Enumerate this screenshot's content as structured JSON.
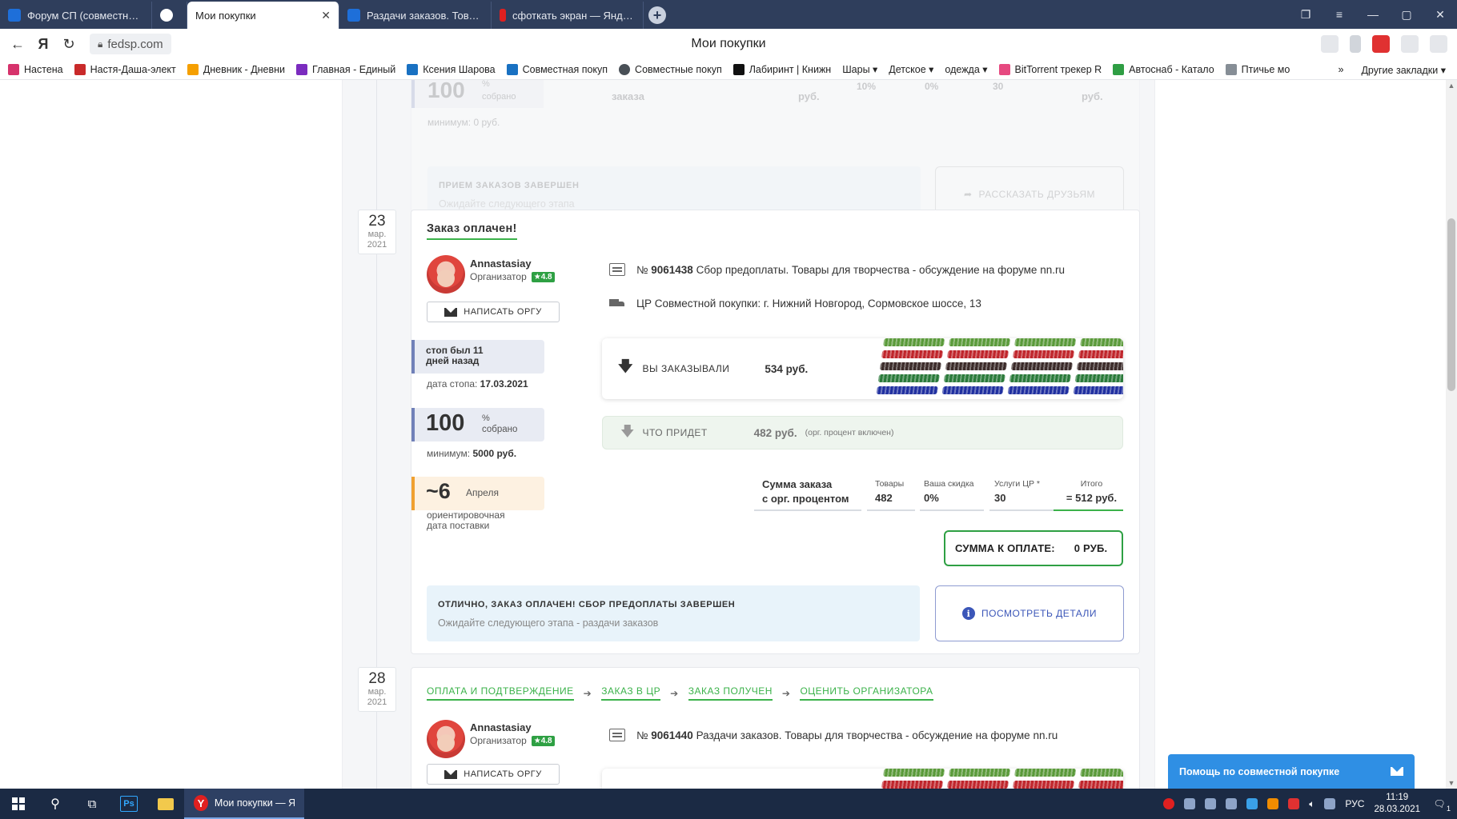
{
  "browser": {
    "tabs": [
      {
        "label": "Форум СП (совместных покупок)",
        "color": "#1e6fd9",
        "active": false
      },
      {
        "label": "",
        "color": "#2f3e5c",
        "active": false
      },
      {
        "label": "Мои покупки",
        "color": "#ffffff",
        "active": true
      },
      {
        "label": "Раздачи заказов. Товары",
        "color": "#1e6fd9",
        "active": false
      },
      {
        "label": "сфоткать экран — Яндекс",
        "color": "#e02020",
        "active": false
      }
    ],
    "url": "fedsp.com",
    "page_title": "Мои покупки",
    "bookmarks": [
      {
        "label": "Настена",
        "color": "#d6336c"
      },
      {
        "label": "Настя-Даша-элект",
        "color": "#c92a2a"
      },
      {
        "label": "Дневник - Дневни",
        "color": "#f59f00"
      },
      {
        "label": "Главная - Единый",
        "color": "#7b2cbf"
      },
      {
        "label": "Ксения Шарова",
        "color": "#1971c2"
      },
      {
        "label": "Совместная покуп",
        "color": "#1971c2"
      },
      {
        "label": "Совместные покуп",
        "color": "#495057"
      },
      {
        "label": "Лабиринт | Книжн",
        "color": "#111111"
      },
      {
        "label": "Шары ▾",
        "color": ""
      },
      {
        "label": "Детское ▾",
        "color": ""
      },
      {
        "label": "одежда ▾",
        "color": ""
      },
      {
        "label": "BitTorrent трекер R",
        "color": "#e64980"
      },
      {
        "label": "Автоснаб - Катало",
        "color": "#2f9e44"
      },
      {
        "label": "Птичье мо",
        "color": "#868e96"
      }
    ],
    "other_bookmarks": "Другие закладки ▾"
  },
  "faded_card": {
    "percent": "100",
    "percent_unit": "%",
    "percent_label": "собрано",
    "minimum": "минимум: 0 руб.",
    "col1": "заказа",
    "col2": "руб.",
    "col3": "10%",
    "col4": "0%",
    "col5": "30",
    "col6": "руб.",
    "notice_title": "ПРИЕМ ЗАКАЗОВ ЗАВЕРШЕН",
    "notice_sub": "Ожидайте следующего этапа",
    "share_button": "РАССКАЗАТЬ ДРУЗЬЯМ"
  },
  "order1": {
    "date_day": "23",
    "date_month": "мар.",
    "date_year": "2021",
    "status": "Заказ оплачен!",
    "organizer_name": "Annastasiay",
    "organizer_role": "Организатор",
    "rating": "★4.8",
    "write_button": "НАПИСАТЬ ОРГУ",
    "order_no_prefix": "№",
    "order_no": "9061438",
    "order_title": "Сбор предоплаты. Товары для творчества - обсуждение на форуме nn.ru",
    "pickup": "ЦР Совместной покупки: г. Нижний Новгород, Сормовское шоссе, 13",
    "stop_line1": "стоп был 11",
    "stop_line2": "дней назад",
    "stop_date_label": "дата стопа:",
    "stop_date": "17.03.2021",
    "percent": "100",
    "percent_unit": "%",
    "percent_label": "собрано",
    "minimum_label": "минимум:",
    "minimum_value": "5000 руб.",
    "delivery_approx": "~6",
    "delivery_month": "Апреля",
    "delivery_line1": "ориентировочная",
    "delivery_line2": "дата поставки",
    "ordered_label": "ВЫ ЗАКАЗЫВАЛИ",
    "ordered_value": "534 руб.",
    "arrive_label": "ЧТО ПРИДЕТ",
    "arrive_value": "482 руб.",
    "arrive_note": "(орг. процент включен)",
    "sum_label_line1": "Сумма заказа",
    "sum_label_line2": "с орг. процентом",
    "goods_label": "Товары",
    "goods_value": "482",
    "discount_label": "Ваша скидка",
    "discount_value": "0%",
    "services_label": "Услуги ЦР *",
    "services_value": "30",
    "total_label": "Итого",
    "total_value": "= 512 руб.",
    "pay_label": "СУММА К ОПЛАТЕ:",
    "pay_value": "0 РУБ.",
    "notice_title": "ОТЛИЧНО, ЗАКАЗ ОПЛАЧЕН! СБОР ПРЕДОПЛАТЫ ЗАВЕРШЕН",
    "notice_sub": "Ожидайте следующего этапа - раздачи заказов",
    "details_button": "ПОСМОТРЕТЬ ДЕТАЛИ"
  },
  "order2": {
    "date_day": "28",
    "date_month": "мар.",
    "date_year": "2021",
    "steps": [
      "ОПЛАТА И ПОДТВЕРЖДЕНИЕ",
      "ЗАКАЗ В ЦР",
      "ЗАКАЗ ПОЛУЧЕН",
      "ОЦЕНИТЬ ОРГАНИЗАТОРА"
    ],
    "organizer_name": "Annastasiay",
    "organizer_role": "Организатор",
    "rating": "★4.8",
    "write_button": "НАПИСАТЬ ОРГУ",
    "order_no_prefix": "№",
    "order_no": "9061440",
    "order_title": "Раздачи заказов. Товары для творчества - обсуждение на форуме nn.ru"
  },
  "help_widget": "Помощь по совместной покупке",
  "taskbar": {
    "app_label": "Мои покупки — Я...",
    "lang": "РУС",
    "time": "11:19",
    "date": "28.03.2021",
    "notifications": "1"
  },
  "colors": {
    "accent_green": "#3bb24a",
    "link_blue": "#3b56b8",
    "tabbar": "#2f3e5c"
  }
}
